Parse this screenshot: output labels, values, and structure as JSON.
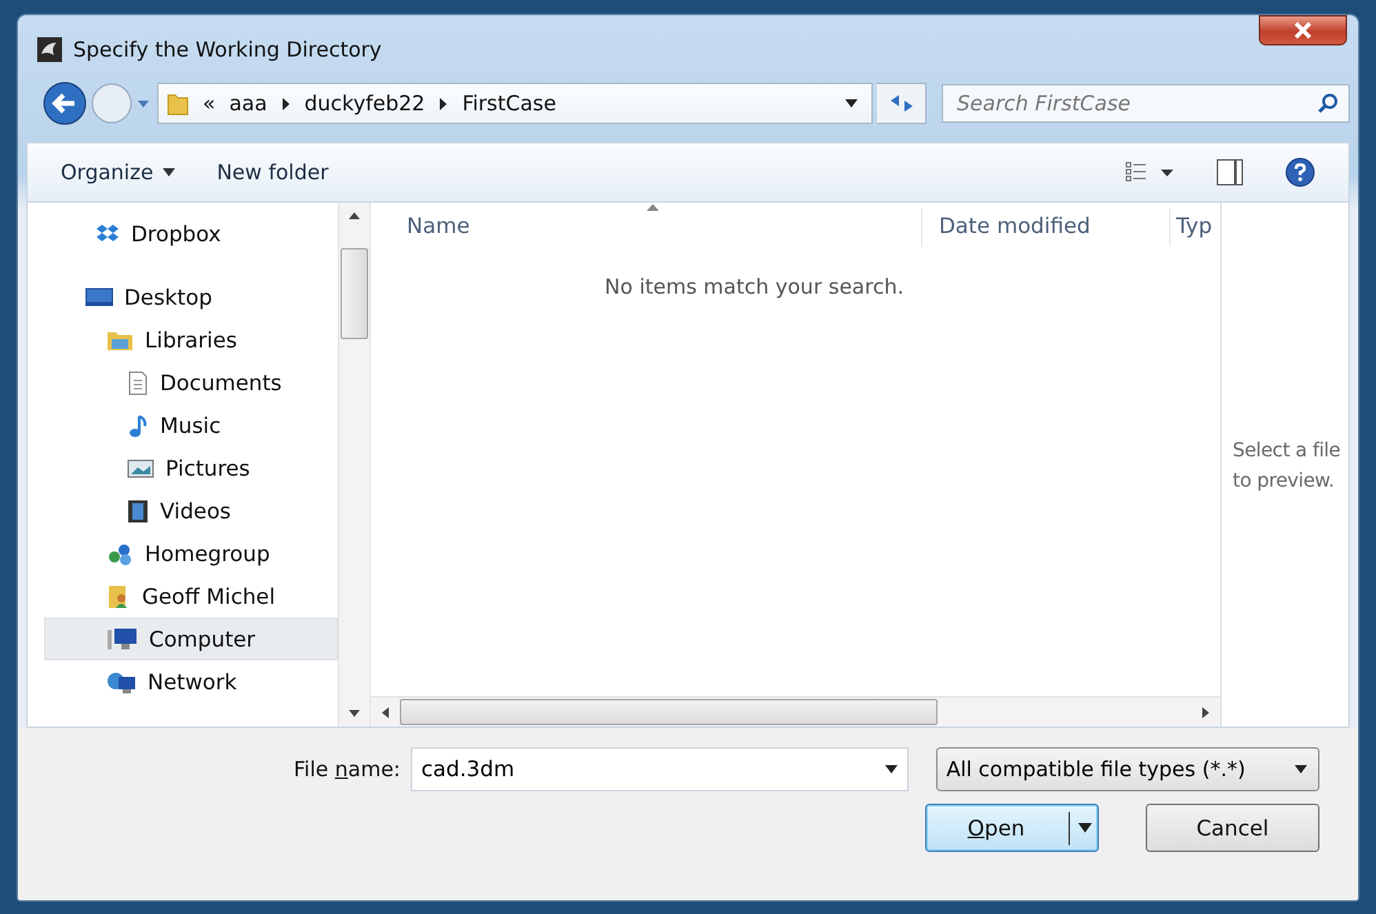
{
  "window": {
    "title": "Specify the Working Directory"
  },
  "address": {
    "overflow": "«",
    "path": [
      "aaa",
      "duckyfeb22",
      "FirstCase"
    ]
  },
  "search": {
    "placeholder": "Search FirstCase"
  },
  "toolbar": {
    "organize": "Organize",
    "new_folder": "New folder"
  },
  "sidebar": {
    "favorites": [
      {
        "label": "Dropbox",
        "selected": false
      }
    ],
    "items": [
      {
        "label": "Desktop",
        "selected": false,
        "children": [
          {
            "label": "Libraries",
            "selected": false,
            "children": [
              {
                "label": "Documents",
                "selected": false
              },
              {
                "label": "Music",
                "selected": false
              },
              {
                "label": "Pictures",
                "selected": false
              },
              {
                "label": "Videos",
                "selected": false
              }
            ]
          },
          {
            "label": "Homegroup",
            "selected": false
          },
          {
            "label": "Geoff Michel",
            "selected": false
          },
          {
            "label": "Computer",
            "selected": true
          },
          {
            "label": "Network",
            "selected": false
          }
        ]
      }
    ]
  },
  "file_list": {
    "columns": [
      "Name",
      "Date modified",
      "Typ"
    ],
    "empty_message": "No items match your search."
  },
  "preview": {
    "message": "Select a file to preview."
  },
  "file_name": {
    "label": {
      "before": "File ",
      "key": "n",
      "after": "ame:"
    },
    "value": "cad.3dm"
  },
  "file_type": {
    "value": "All compatible file types (*.*)"
  },
  "buttons": [
    {
      "kind": "split",
      "key": "O",
      "after": "pen",
      "default": true
    },
    {
      "kind": "plain",
      "before": "Cancel",
      "default": false
    }
  ]
}
